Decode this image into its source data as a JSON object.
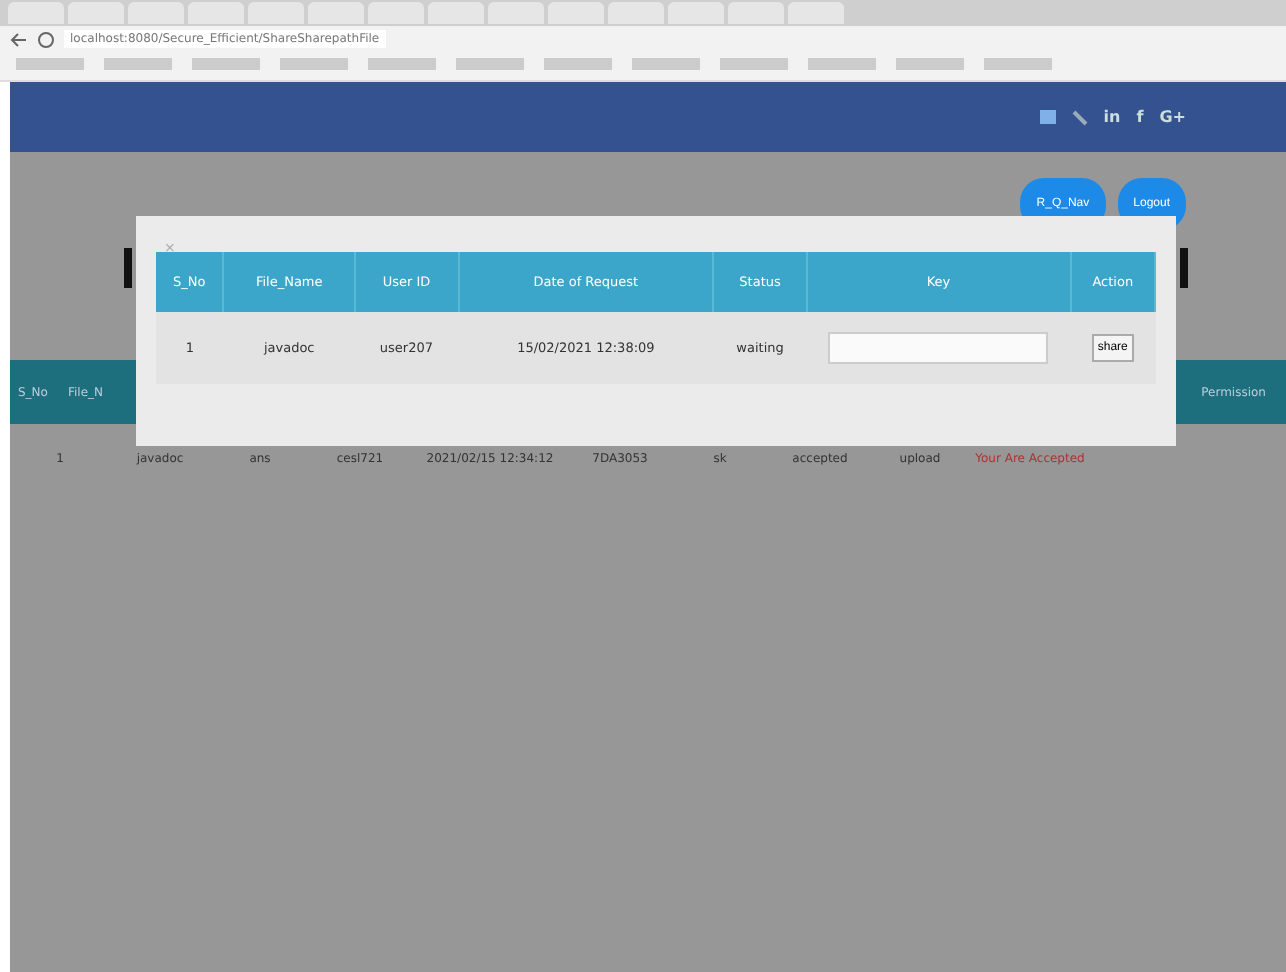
{
  "browser": {
    "address": "localhost:8080/Secure_Efficient/ShareSharepathFile"
  },
  "header": {
    "social": [
      "in",
      "f",
      "G+"
    ]
  },
  "nav_buttons": [
    {
      "label": "R_Q_Nav"
    },
    {
      "label": "Logout"
    }
  ],
  "background_table": {
    "columns": [
      "S_No",
      "File_N",
      "Permission"
    ],
    "row": [
      "1",
      "javadoc",
      "ans",
      "cesl721",
      "2021/02/15 12:34:12",
      "7DA3053",
      "sk",
      "accepted",
      "upload",
      "Your Are Accepted"
    ]
  },
  "modal": {
    "close": "×",
    "columns": [
      "S_No",
      "File_Name",
      "User ID",
      "Date of Request",
      "Status",
      "Key",
      "Action"
    ],
    "rows": [
      {
        "cells": [
          "1",
          "javadoc",
          "user207",
          "15/02/2021 12:38:09",
          "waiting"
        ],
        "action": "share"
      }
    ]
  }
}
